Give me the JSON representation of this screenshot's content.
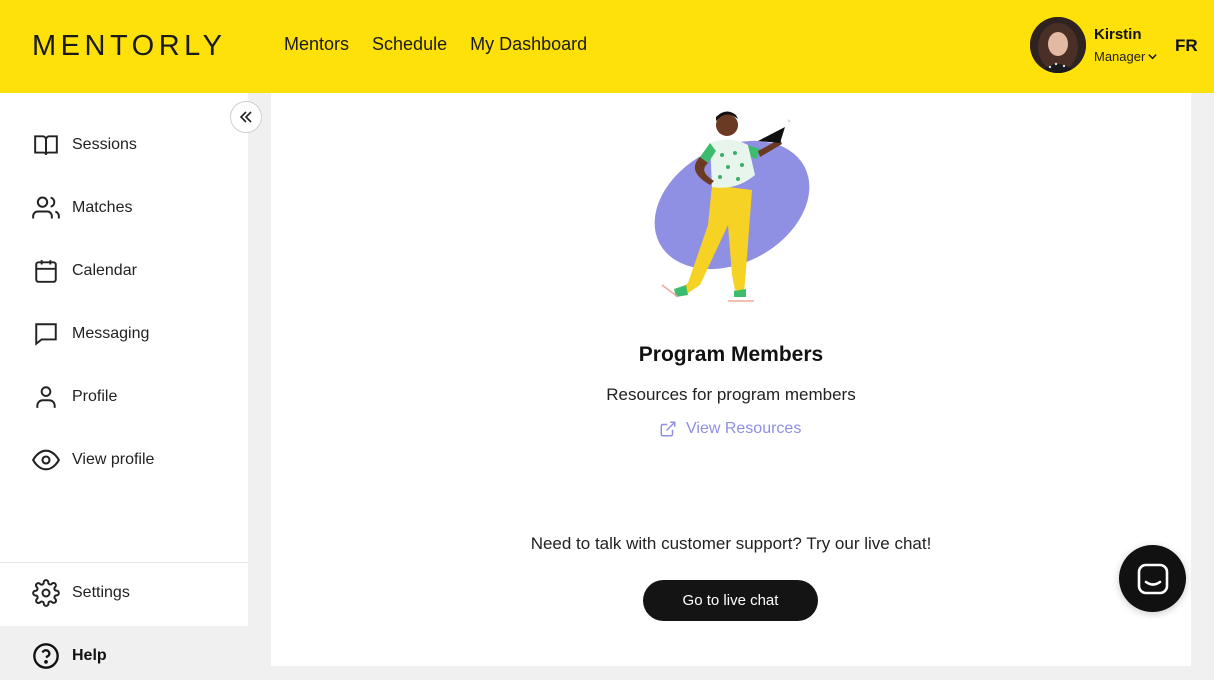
{
  "header": {
    "logo": "MENTORLY",
    "nav": [
      "Mentors",
      "Schedule",
      "My Dashboard"
    ],
    "user": {
      "name": "Kirstin",
      "role": "Manager"
    },
    "language": "FR",
    "background_color": "#ffe10a"
  },
  "sidebar": {
    "items": [
      {
        "label": "Sessions",
        "icon": "book-icon"
      },
      {
        "label": "Matches",
        "icon": "users-icon"
      },
      {
        "label": "Calendar",
        "icon": "calendar-icon"
      },
      {
        "label": "Messaging",
        "icon": "message-icon"
      },
      {
        "label": "Profile",
        "icon": "user-icon"
      },
      {
        "label": "View profile",
        "icon": "eye-icon"
      }
    ],
    "settings": {
      "label": "Settings",
      "icon": "gear-icon"
    },
    "help": {
      "label": "Help",
      "icon": "question-icon"
    }
  },
  "main": {
    "title": "Program Members",
    "subtitle": "Resources for program members",
    "resources_link": "View Resources",
    "support_text": "Need to talk with customer support? Try our live chat!",
    "chat_button": "Go to live chat",
    "accent_color": "#8f8fe3"
  }
}
